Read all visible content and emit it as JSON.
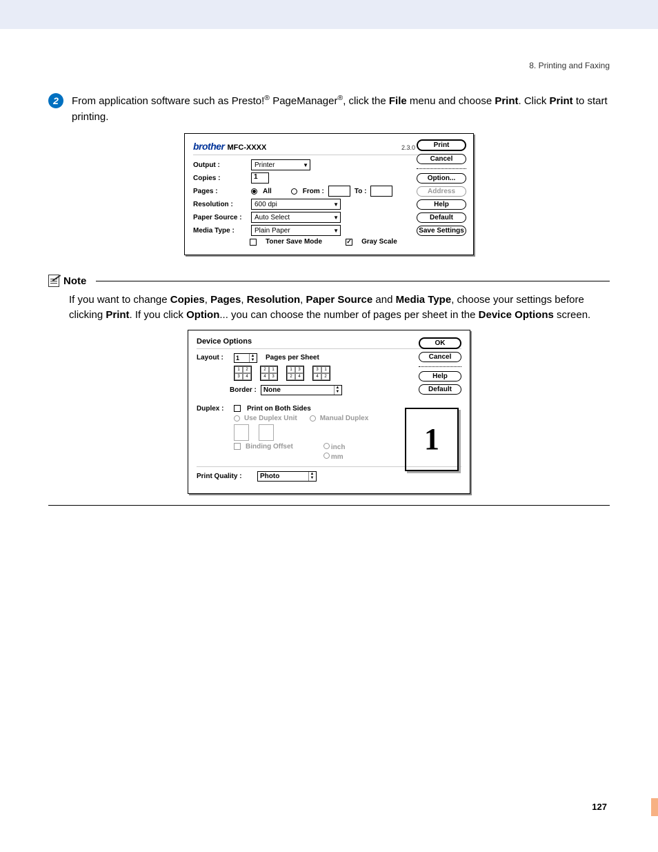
{
  "header": {
    "section": "8. Printing and Faxing"
  },
  "step": {
    "num": "2",
    "text_before": "From application software such as Presto!",
    "reg1": "®",
    "text_mid1": " PageManager",
    "reg2": "®",
    "text_mid2": ", click the ",
    "bold_file": "File",
    "text_mid3": " menu and choose ",
    "bold_print": "Print",
    "text_mid4": ". Click ",
    "bold_print2": "Print",
    "text_end": " to start printing."
  },
  "dialog1": {
    "brand": "brother",
    "model": "MFC-XXXX",
    "version": "2.3.0",
    "output_label": "Output :",
    "output_value": "Printer",
    "copies_label": "Copies :",
    "copies_value": "1",
    "pages_label": "Pages :",
    "pages_all": "All",
    "pages_from": "From :",
    "pages_to": "To :",
    "resolution_label": "Resolution :",
    "resolution_value": "600 dpi",
    "source_label": "Paper Source :",
    "source_value": "Auto Select",
    "media_label": "Media Type :",
    "media_value": "Plain Paper",
    "toner_save": "Toner Save Mode",
    "gray_scale": "Gray Scale",
    "buttons": {
      "print": "Print",
      "cancel": "Cancel",
      "option": "Option...",
      "address": "Address",
      "help": "Help",
      "default": "Default",
      "save": "Save Settings"
    }
  },
  "note": {
    "title": "Note",
    "t1": "If you want to change ",
    "b_copies": "Copies",
    "c1": ", ",
    "b_pages": "Pages",
    "c2": ", ",
    "b_res": "Resolution",
    "c3": ", ",
    "b_src": "Paper Source",
    "t_and": " and ",
    "b_media": "Media Type",
    "t2": ", choose your settings before clicking ",
    "b_print": "Print",
    "t3": ". If you click ",
    "b_option": "Option",
    "t4": "... you can choose the number of pages per sheet in the ",
    "b_dev": "Device Options",
    "t5": " screen."
  },
  "dialog2": {
    "title": "Device Options",
    "layout_label": "Layout :",
    "layout_value": "1",
    "pps": "Pages per Sheet",
    "icon_labels": [
      [
        "1",
        "2",
        "3",
        "4"
      ],
      [
        "2",
        "1",
        "4",
        "3"
      ],
      [
        "1",
        "3",
        "2",
        "4"
      ],
      [
        "3",
        "1",
        "4",
        "2"
      ]
    ],
    "border_label": "Border :",
    "border_value": "None",
    "duplex_label": "Duplex :",
    "print_both": "Print on Both Sides",
    "use_duplex": "Use Duplex Unit",
    "manual_duplex": "Manual Duplex",
    "binding_offset": "Binding Offset",
    "inch": "inch",
    "mm": "mm",
    "pq_label": "Print Quality :",
    "pq_value": "Photo",
    "preview": "1",
    "buttons": {
      "ok": "OK",
      "cancel": "Cancel",
      "help": "Help",
      "default": "Default"
    }
  },
  "page_number": "127"
}
